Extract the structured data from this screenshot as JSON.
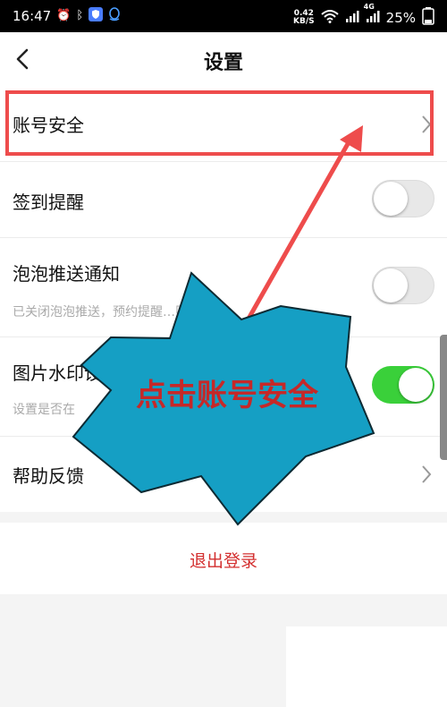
{
  "status_bar": {
    "time": "16:47",
    "net_speed_value": "0.42",
    "net_speed_unit": "KB/S",
    "signal_badge": "4G",
    "battery": "25%"
  },
  "header": {
    "title": "设置"
  },
  "settings": {
    "account_security": {
      "label": "账号安全"
    },
    "signin_reminder": {
      "label": "签到提醒",
      "toggle": "off"
    },
    "bubble_push": {
      "label": "泡泡推送通知",
      "subtitle": "已关闭泡泡推送，预约提醒…则会失效",
      "toggle": "off"
    },
    "image_watermark": {
      "label": "图片水印设",
      "subtitle": "设置是否在",
      "toggle": "on"
    },
    "help_feedback": {
      "label": "帮助反馈"
    }
  },
  "logout": {
    "label": "退出登录"
  },
  "annotation": {
    "callout_text": "点击账号安全",
    "callout_color": "#159fc4",
    "arrow_color": "#ee4c4c"
  },
  "colors": {
    "toggle_on": "#3ad03a",
    "logout_text": "#d32f2f"
  }
}
